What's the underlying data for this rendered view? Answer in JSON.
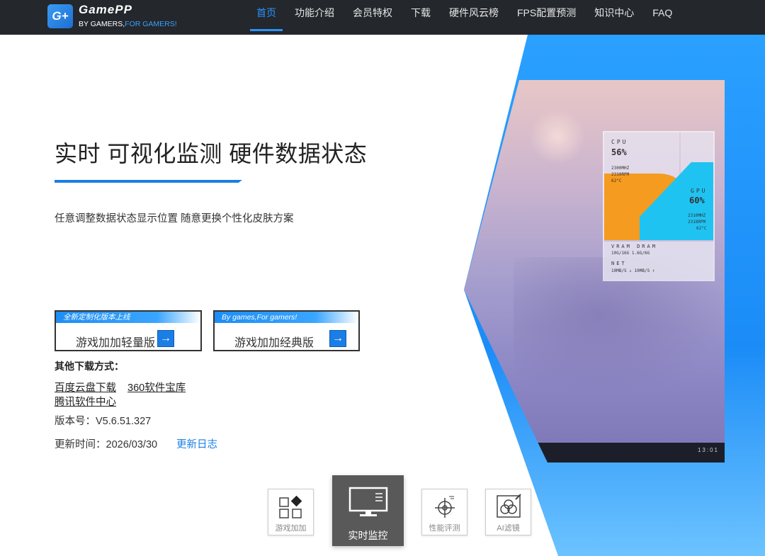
{
  "logo": {
    "badge": "G+",
    "name": "GamePP",
    "sub_prefix": "BY GAMERS,",
    "sub_highlight": "FOR GAMERS!"
  },
  "nav": {
    "items": [
      {
        "label": "首页",
        "active": true
      },
      {
        "label": "功能介绍"
      },
      {
        "label": "会员特权"
      },
      {
        "label": "下载"
      },
      {
        "label": "硬件风云榜"
      },
      {
        "label": "FPS配置预测"
      },
      {
        "label": "知识中心"
      },
      {
        "label": "FAQ"
      }
    ]
  },
  "hero": {
    "headline": "实时 可视化监测 硬件数据状态",
    "subline": "任意调整数据状态显示位置   随意更换个性化皮肤方案"
  },
  "monitor": {
    "cpu_label": "CPU",
    "cpu_value": "56%",
    "cpu_details": [
      "2300MHZ",
      "2310RPM",
      "62°C"
    ],
    "gpu_label": "GPU",
    "gpu_value": "60%",
    "gpu_details": [
      "2310MHZ",
      "2318RPM",
      "62°C"
    ],
    "mem_label": "VRAM  DRAM",
    "mem_value": "10G/16G   1.6G/6G",
    "net_label": "NET",
    "net_value": "10MB/S ↓   10MB/S ↑",
    "tray_time": "13:01"
  },
  "downloads": {
    "lite": {
      "tag": "全新定制化版本上线",
      "label": "游戏加加轻量版",
      "arrow": "→"
    },
    "classic": {
      "tag": "By games,For gamers!",
      "label": "游戏加加经典版",
      "arrow": "→"
    },
    "other_title": "其他下载方式：",
    "links": [
      "百度云盘下载",
      "360软件宝库",
      "腾讯软件中心"
    ],
    "version": "版本号：V5.6.51.327",
    "updated": "更新时间：2026/03/30",
    "changelog": "更新日志"
  },
  "features": [
    {
      "label": "游戏加加",
      "icon": "grid-diamond-icon"
    },
    {
      "label": "实时监控",
      "icon": "monitor-icon",
      "active": true
    },
    {
      "label": "性能评测",
      "icon": "crosshair-icon"
    },
    {
      "label": "AI滤镜",
      "icon": "rgb-filter-icon"
    }
  ]
}
